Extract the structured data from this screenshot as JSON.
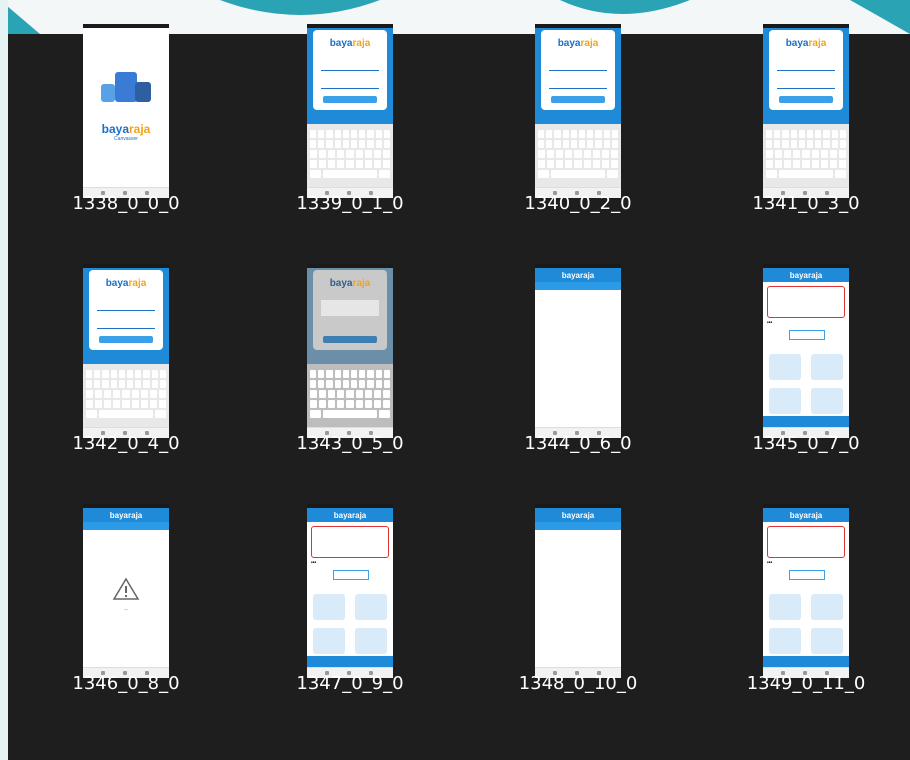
{
  "files": [
    {
      "name": "1338_0_0_0",
      "screen": "splash"
    },
    {
      "name": "1339_0_1_0",
      "screen": "login-keyboard"
    },
    {
      "name": "1340_0_2_0",
      "screen": "login-keyboard"
    },
    {
      "name": "1341_0_3_0",
      "screen": "login-keyboard"
    },
    {
      "name": "1342_0_4_0",
      "screen": "login-keyboard"
    },
    {
      "name": "1343_0_5_0",
      "screen": "login-loading"
    },
    {
      "name": "1344_0_6_0",
      "screen": "blank-list"
    },
    {
      "name": "1345_0_7_0",
      "screen": "dashboard"
    },
    {
      "name": "1346_0_8_0",
      "screen": "empty-warning"
    },
    {
      "name": "1347_0_9_0",
      "screen": "dashboard"
    },
    {
      "name": "1348_0_10_0",
      "screen": "blank-list"
    },
    {
      "name": "1349_0_11_0",
      "screen": "dashboard"
    }
  ],
  "colors": {
    "background": "#1e1e1e",
    "caption": "#ffffff",
    "brand_blue": "#1e8ad8",
    "brand_orange": "#f4a21a"
  }
}
